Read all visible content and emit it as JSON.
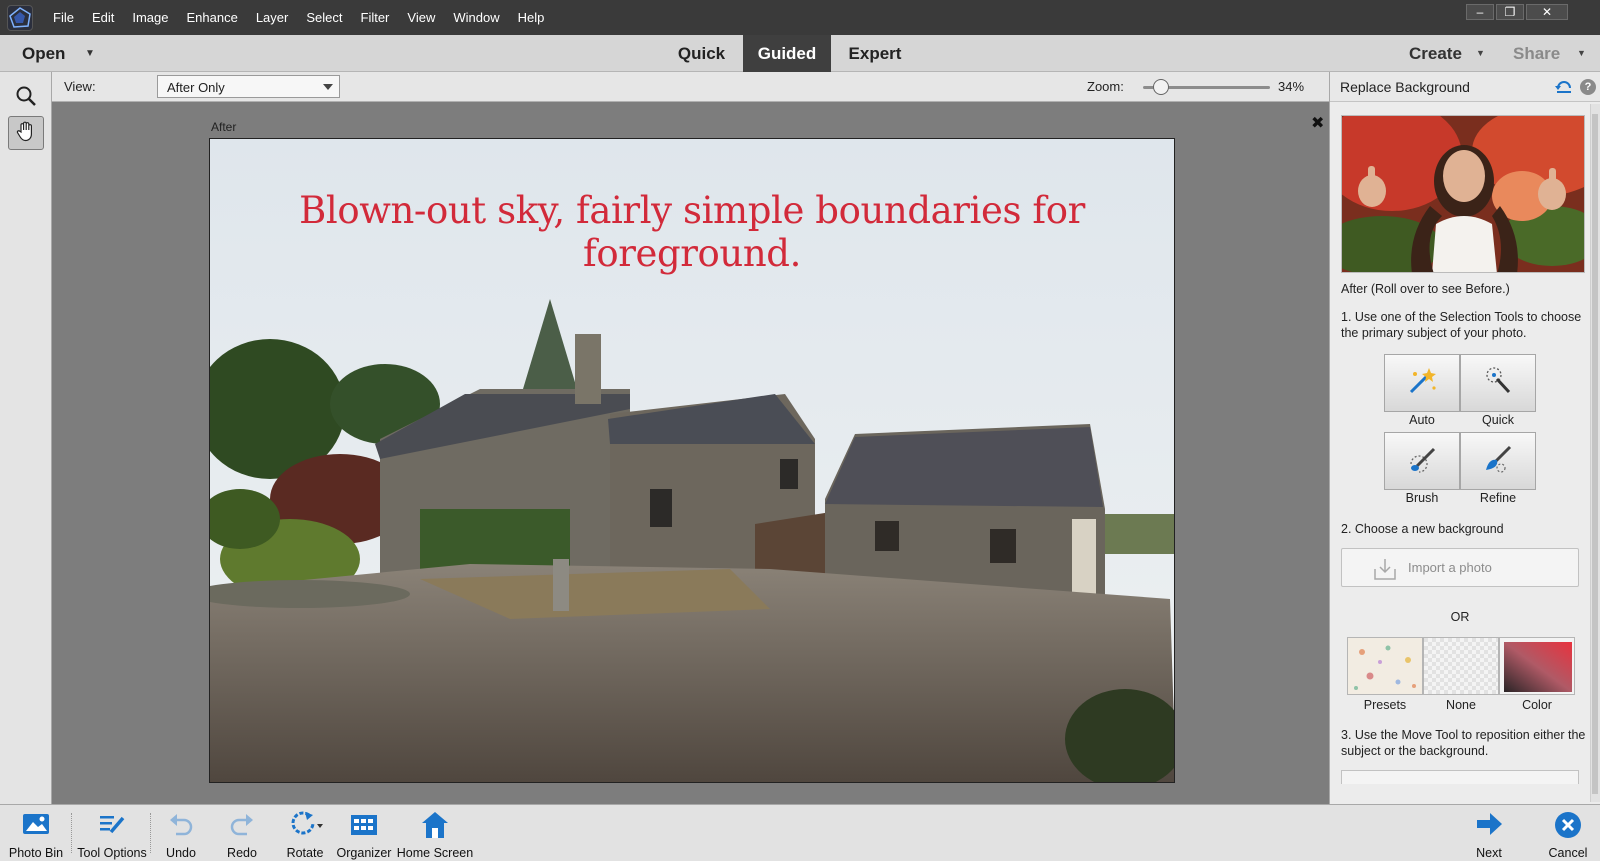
{
  "menu": {
    "items": [
      "File",
      "Edit",
      "Image",
      "Enhance",
      "Layer",
      "Select",
      "Filter",
      "View",
      "Window",
      "Help"
    ]
  },
  "window_controls": {
    "minimize": "‒",
    "restore": "❐",
    "close": "✕"
  },
  "modebar": {
    "open_label": "Open",
    "tabs": [
      {
        "label": "Quick",
        "active": false
      },
      {
        "label": "Guided",
        "active": true
      },
      {
        "label": "Expert",
        "active": false
      }
    ],
    "create_label": "Create",
    "share_label": "Share"
  },
  "toolbox": {
    "tools": [
      {
        "name": "zoom-tool",
        "icon": "magnifier-icon",
        "selected": false
      },
      {
        "name": "hand-tool",
        "icon": "hand-icon",
        "selected": true
      }
    ]
  },
  "options": {
    "view_label": "View:",
    "view_value": "After Only",
    "zoom_label": "Zoom:",
    "zoom_value": "34%",
    "zoom_percent": 34
  },
  "canvas": {
    "after_label": "After",
    "close_glyph": "✖",
    "photo_caption": "Blown-out sky, fairly simple boundaries for foreground."
  },
  "panel": {
    "title": "Replace Background",
    "help_glyph": "?",
    "preview_caption": "After (Roll over to see Before.)",
    "step1": "1. Use one of the Selection Tools to choose the primary subject of your photo.",
    "selection_tools": [
      "Auto",
      "Quick",
      "Brush",
      "Refine"
    ],
    "step2": "2. Choose a new background",
    "import_label": "Import a photo",
    "or_label": "OR",
    "background_options": [
      "Presets",
      "None",
      "Color"
    ],
    "step3": "3. Use the Move Tool to reposition either the subject or the background."
  },
  "bottombar": {
    "left_items": [
      {
        "label": "Photo Bin",
        "icon": "photo-bin-icon"
      },
      {
        "label": "Tool Options",
        "icon": "tool-options-icon"
      },
      {
        "label": "Undo",
        "icon": "undo-icon"
      },
      {
        "label": "Redo",
        "icon": "redo-icon"
      },
      {
        "label": "Rotate",
        "icon": "rotate-icon"
      },
      {
        "label": "Organizer",
        "icon": "organizer-icon"
      },
      {
        "label": "Home Screen",
        "icon": "home-icon"
      }
    ],
    "next_label": "Next",
    "cancel_label": "Cancel"
  },
  "colors": {
    "accent_blue": "#1b74c9",
    "caption_red": "#d22a3a",
    "active_tab": "#3f3f3f"
  }
}
